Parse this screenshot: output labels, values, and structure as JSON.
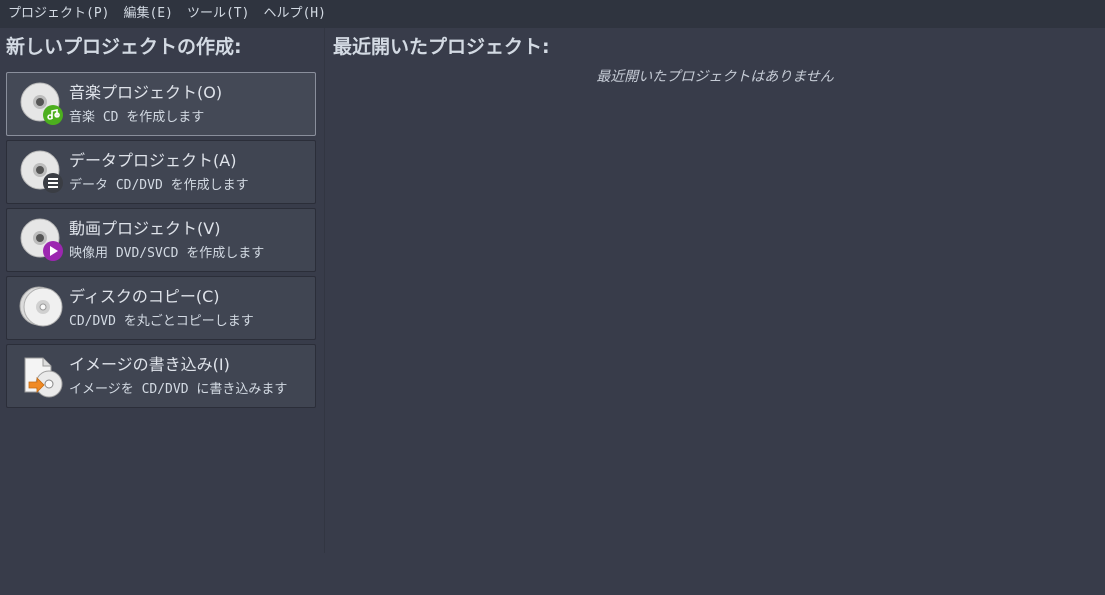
{
  "menubar": {
    "items": [
      "プロジェクト(P)",
      "編集(E)",
      "ツール(T)",
      "ヘルプ(H)"
    ]
  },
  "left": {
    "title": "新しいプロジェクトの作成:",
    "buttons": [
      {
        "title": "音楽プロジェクト(O)",
        "desc": "音楽 CD を作成します",
        "icon": "audio-disc-icon"
      },
      {
        "title": "データプロジェクト(A)",
        "desc": "データ CD/DVD を作成します",
        "icon": "data-disc-icon"
      },
      {
        "title": "動画プロジェクト(V)",
        "desc": "映像用 DVD/SVCD を作成します",
        "icon": "video-disc-icon"
      },
      {
        "title": "ディスクのコピー(C)",
        "desc": "CD/DVD を丸ごとコピーします",
        "icon": "disc-copy-icon"
      },
      {
        "title": "イメージの書き込み(I)",
        "desc": "イメージを CD/DVD に書き込みます",
        "icon": "image-burn-icon"
      }
    ]
  },
  "right": {
    "title": "最近開いたプロジェクト:",
    "empty_message": "最近開いたプロジェクトはありません"
  },
  "colors": {
    "background": "#383c4a",
    "menubar": "#2f343f",
    "button": "#404552",
    "audio_badge": "#4caf1e",
    "data_badge": "#3a3d44",
    "video_badge": "#9c27b0",
    "burn_arrow": "#f08a24"
  }
}
